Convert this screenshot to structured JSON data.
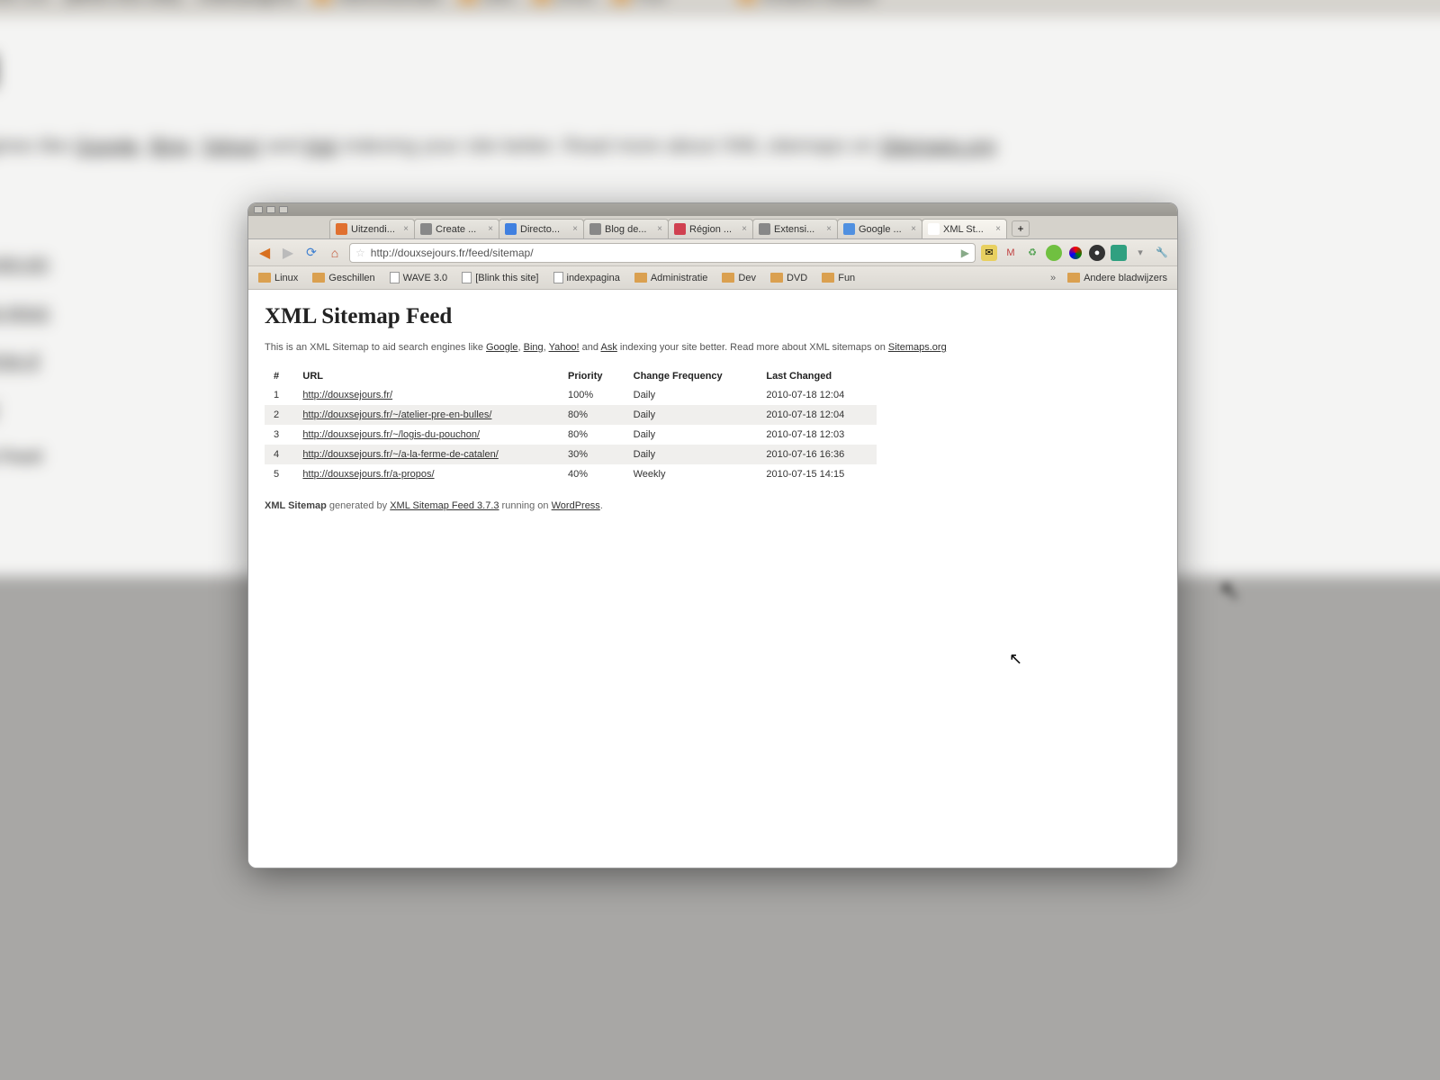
{
  "bg": {
    "title": "map Feed",
    "bookmarks": [
      "schillen",
      "WAVE 3.0",
      "[Blink this site]",
      "indexpagina",
      "Administratie",
      "Dev",
      "DVD",
      "Fun",
      "Andere bladwi"
    ]
  },
  "tabs": [
    {
      "label": "Uitzendi...",
      "favicon": "#e07030"
    },
    {
      "label": "Create ...",
      "favicon": "#888"
    },
    {
      "label": "Directo...",
      "favicon": "#4080e0"
    },
    {
      "label": "Blog de...",
      "favicon": "#888"
    },
    {
      "label": "Région ...",
      "favicon": "#d04050"
    },
    {
      "label": "Extensi...",
      "favicon": "#888"
    },
    {
      "label": "Google ...",
      "favicon": "#5090e0"
    },
    {
      "label": "XML St...",
      "favicon": "#fff",
      "active": true
    }
  ],
  "address": "http://douxsejours.fr/feed/sitemap/",
  "bookmarks": [
    {
      "label": "Linux",
      "folder": true
    },
    {
      "label": "Geschillen",
      "folder": true
    },
    {
      "label": "WAVE 3.0",
      "folder": false
    },
    {
      "label": "[Blink this site]",
      "folder": false
    },
    {
      "label": "indexpagina",
      "folder": false
    },
    {
      "label": "Administratie",
      "folder": true
    },
    {
      "label": "Dev",
      "folder": true
    },
    {
      "label": "DVD",
      "folder": true
    },
    {
      "label": "Fun",
      "folder": true
    }
  ],
  "other_bookmarks": "Andere bladwijzers",
  "page": {
    "title": "XML Sitemap Feed",
    "intro_pre": "This is an XML Sitemap to aid search engines like ",
    "intro_links": {
      "google": "Google",
      "bing": "Bing",
      "yahoo": "Yahoo!",
      "ask": "Ask"
    },
    "intro_and": " and ",
    "intro_mid": " indexing your site better. Read more about XML sitemaps on ",
    "intro_sitemaps": "Sitemaps.org",
    "headers": {
      "num": "#",
      "url": "URL",
      "priority": "Priority",
      "freq": "Change Frequency",
      "changed": "Last Changed"
    },
    "rows": [
      {
        "n": "1",
        "url": "http://douxsejours.fr/",
        "priority": "100%",
        "freq": "Daily",
        "changed": "2010-07-18 12:04"
      },
      {
        "n": "2",
        "url": "http://douxsejours.fr/~/atelier-pre-en-bulles/",
        "priority": "80%",
        "freq": "Daily",
        "changed": "2010-07-18 12:04"
      },
      {
        "n": "3",
        "url": "http://douxsejours.fr/~/logis-du-pouchon/",
        "priority": "80%",
        "freq": "Daily",
        "changed": "2010-07-18 12:03"
      },
      {
        "n": "4",
        "url": "http://douxsejours.fr/~/a-la-ferme-de-catalen/",
        "priority": "30%",
        "freq": "Daily",
        "changed": "2010-07-16 16:36"
      },
      {
        "n": "5",
        "url": "http://douxsejours.fr/a-propos/",
        "priority": "40%",
        "freq": "Weekly",
        "changed": "2010-07-15 14:15"
      }
    ],
    "footer": {
      "bold": "XML Sitemap",
      "gen": " generated by ",
      "plugin": "XML Sitemap Feed 3.7.3",
      "running": " running on ",
      "platform": "WordPress"
    }
  },
  "chart_data": {
    "type": "table",
    "title": "XML Sitemap Feed",
    "columns": [
      "#",
      "URL",
      "Priority",
      "Change Frequency",
      "Last Changed"
    ],
    "rows": [
      [
        "1",
        "http://douxsejours.fr/",
        "100%",
        "Daily",
        "2010-07-18 12:04"
      ],
      [
        "2",
        "http://douxsejours.fr/~/atelier-pre-en-bulles/",
        "80%",
        "Daily",
        "2010-07-18 12:04"
      ],
      [
        "3",
        "http://douxsejours.fr/~/logis-du-pouchon/",
        "80%",
        "Daily",
        "2010-07-18 12:03"
      ],
      [
        "4",
        "http://douxsejours.fr/~/a-la-ferme-de-catalen/",
        "30%",
        "Daily",
        "2010-07-16 16:36"
      ],
      [
        "5",
        "http://douxsejours.fr/a-propos/",
        "40%",
        "Weekly",
        "2010-07-15 14:15"
      ]
    ]
  }
}
